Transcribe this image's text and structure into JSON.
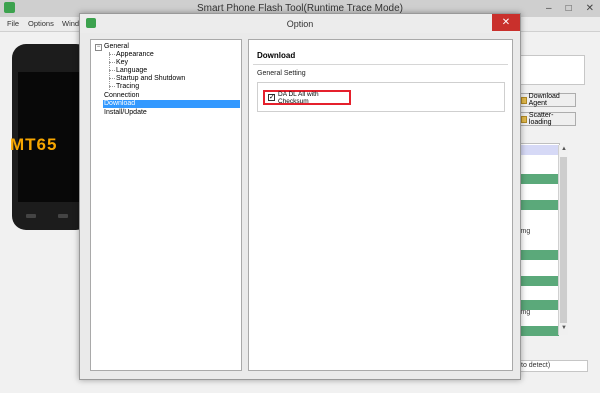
{
  "main_window": {
    "title": "Smart Phone Flash Tool(Runtime Trace Mode)",
    "minimize": "–",
    "maximize": "□",
    "close": "✕",
    "menu": [
      "File",
      "Options",
      "Wind"
    ],
    "phone_model": "MT65",
    "buttons": {
      "download_agent": "Download Agent",
      "scatter_loading": "Scatter-loading"
    },
    "table_fragments": [
      "img",
      "img"
    ],
    "status_text": "to detect)"
  },
  "dialog": {
    "title": "Option",
    "close": "✕",
    "tree": {
      "general": "General",
      "general_children": [
        "Appearance",
        "Key",
        "Language",
        "Startup and Shutdown",
        "Tracing"
      ],
      "connection": "Connection",
      "download": "Download",
      "install_update": "Install/Update",
      "expand_glyph": "−"
    },
    "page": {
      "heading": "Download",
      "group_label": "General Setting",
      "checkbox_label": "DA DL All with Checksum",
      "checkbox_checked": true,
      "checkbox_mark": "✓"
    }
  },
  "colors": {
    "selection": "#3399ff",
    "highlight_border": "#e5202c",
    "close_button": "#c9302c",
    "table_row_green": "#5ba97a",
    "table_header": "#d6d9f6",
    "phone_model_text": "#f7a600"
  }
}
